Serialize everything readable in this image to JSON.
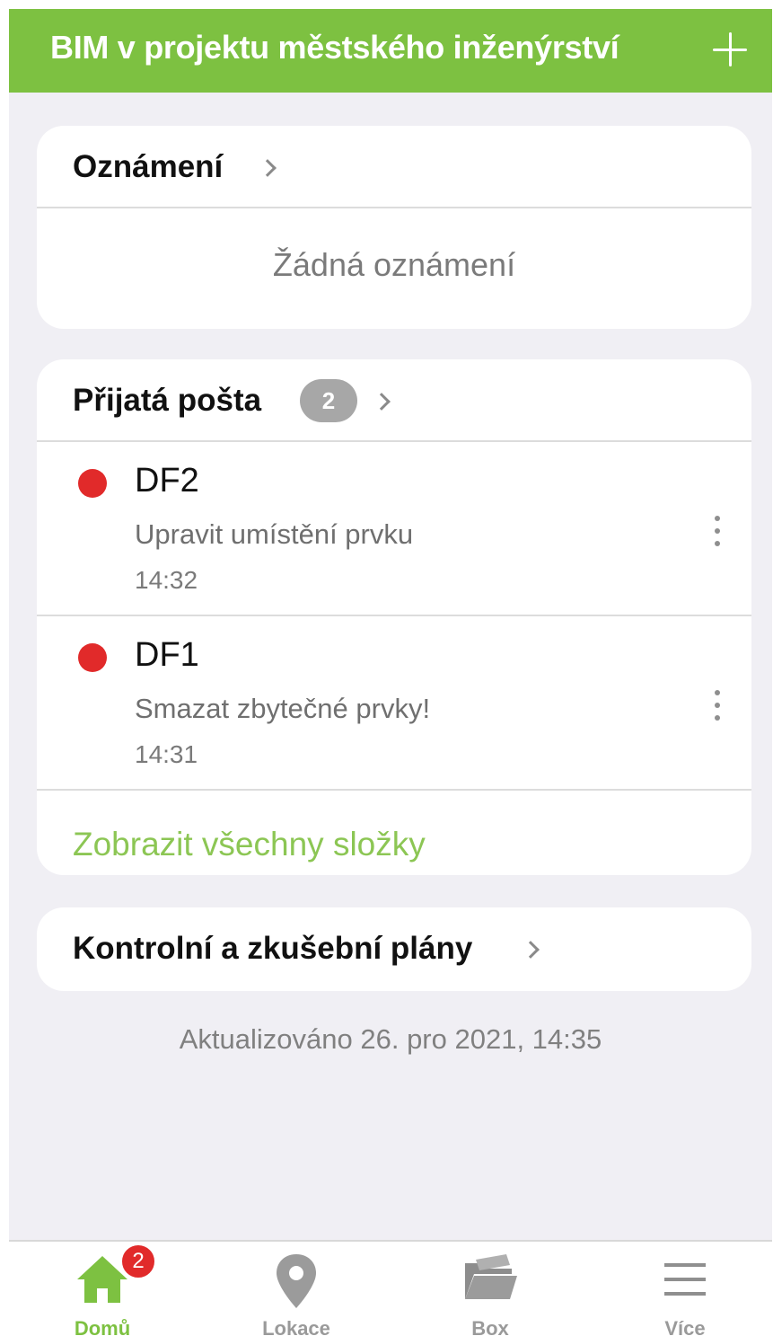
{
  "header": {
    "title": "BIM v projektu městského inženýrství",
    "add_icon": "plus-icon"
  },
  "announcements": {
    "title": "Oznámení",
    "empty_message": "Žádná oznámení"
  },
  "inbox": {
    "title": "Přijatá pošta",
    "count": "2",
    "items": [
      {
        "sender": "DF2",
        "subject": "Upravit umístění prvku",
        "time": "14:32",
        "unread": true
      },
      {
        "sender": "DF1",
        "subject": "Smazat zbytečné prvky!",
        "time": "14:31",
        "unread": true
      }
    ],
    "show_all": "Zobrazit všechny složky"
  },
  "inspection_plans": {
    "title": "Kontrolní a zkušební plány"
  },
  "updated_text": "Aktualizováno 26. pro 2021, 14:35",
  "tabbar": {
    "tabs": [
      {
        "label": "Domů",
        "icon": "home-icon",
        "badge": "2",
        "active": true
      },
      {
        "label": "Lokace",
        "icon": "map-pin-icon"
      },
      {
        "label": "Box",
        "icon": "folder-icon"
      },
      {
        "label": "Více",
        "icon": "menu-icon"
      }
    ]
  },
  "colors": {
    "accent": "#7dc141",
    "unread_dot": "#e12a2a",
    "link": "#8cc654",
    "background": "#f0eff4"
  }
}
